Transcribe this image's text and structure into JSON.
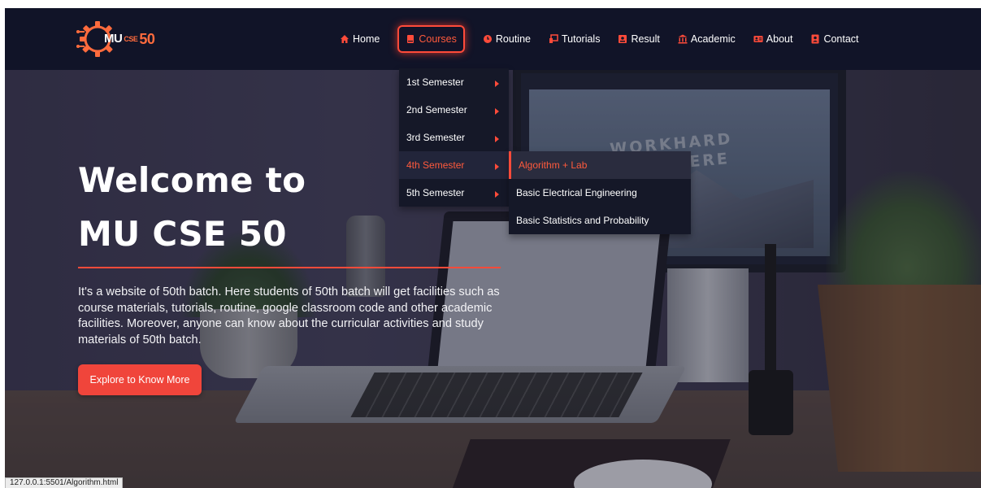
{
  "brand": {
    "logo_mu": "MU",
    "logo_cse": "CSE",
    "logo_num": "50",
    "accent_color": "#ff4b3a"
  },
  "nav": {
    "items": [
      {
        "label": "Home",
        "icon": "home-icon"
      },
      {
        "label": "Courses",
        "icon": "book-icon",
        "active": true
      },
      {
        "label": "Routine",
        "icon": "clock-icon"
      },
      {
        "label": "Tutorials",
        "icon": "video-icon"
      },
      {
        "label": "Result",
        "icon": "result-icon"
      },
      {
        "label": "Academic",
        "icon": "university-icon"
      },
      {
        "label": "About",
        "icon": "id-card-icon"
      },
      {
        "label": "Contact",
        "icon": "contact-icon"
      }
    ]
  },
  "dropdown": {
    "items": [
      {
        "label": "1st Semester"
      },
      {
        "label": "2nd Semester"
      },
      {
        "label": "3rd Semester"
      },
      {
        "label": "4th Semester",
        "active": true
      },
      {
        "label": "5th Semester"
      }
    ]
  },
  "submenu": {
    "items": [
      {
        "label": "Algorithm + Lab",
        "active": true
      },
      {
        "label": "Basic Electrical Engineering"
      },
      {
        "label": "Basic Statistics and Probability"
      }
    ]
  },
  "hero": {
    "title_line1": "Welcome to",
    "title_line2": "MU CSE 50",
    "description": "It's a website of 50th batch. Here students of 50th batch will get facilities such as course materials, tutorials, routine, google classroom code and other academic facilities. Moreover, anyone can know about the curricular activities and study materials of 50th batch.",
    "cta_label": "Explore to Know More"
  },
  "background": {
    "monitor_text": "WORKHARD ANYWHERE"
  },
  "status_bar": {
    "url": "127.0.0.1:5501/Algorithm.html"
  }
}
